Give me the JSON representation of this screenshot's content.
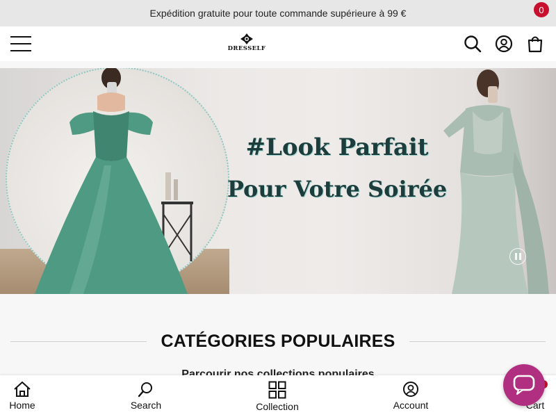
{
  "announcement": {
    "text": "Expédition gratuite pour toute commande supérieure à 99 €"
  },
  "header": {
    "logo_text": "DRESSELF",
    "cart_count": "0",
    "icons": [
      "menu-icon",
      "search-icon",
      "account-icon",
      "cart-icon"
    ]
  },
  "banner": {
    "line1": "#Look Parfait",
    "line2": "Pour Votre Soirée",
    "images": [
      "model-green-ballgown",
      "model-sage-mermaid-gown"
    ]
  },
  "section": {
    "title": "CATÉGORIES POPULAIRES",
    "subtitle": "Parcourir nos collections populaires"
  },
  "bottom_nav": {
    "items": [
      {
        "label": "Home",
        "icon": "home-icon"
      },
      {
        "label": "Search",
        "icon": "search-icon"
      },
      {
        "label": "Collection",
        "icon": "grid-icon"
      },
      {
        "label": "Account",
        "icon": "account-icon"
      },
      {
        "label": "Cart",
        "icon": "cart-icon"
      }
    ]
  },
  "colors": {
    "accent": "#c8102e",
    "chat": "#b12f80",
    "banner_text": "#1d3c3c",
    "dress_green": "#4f9a82"
  }
}
